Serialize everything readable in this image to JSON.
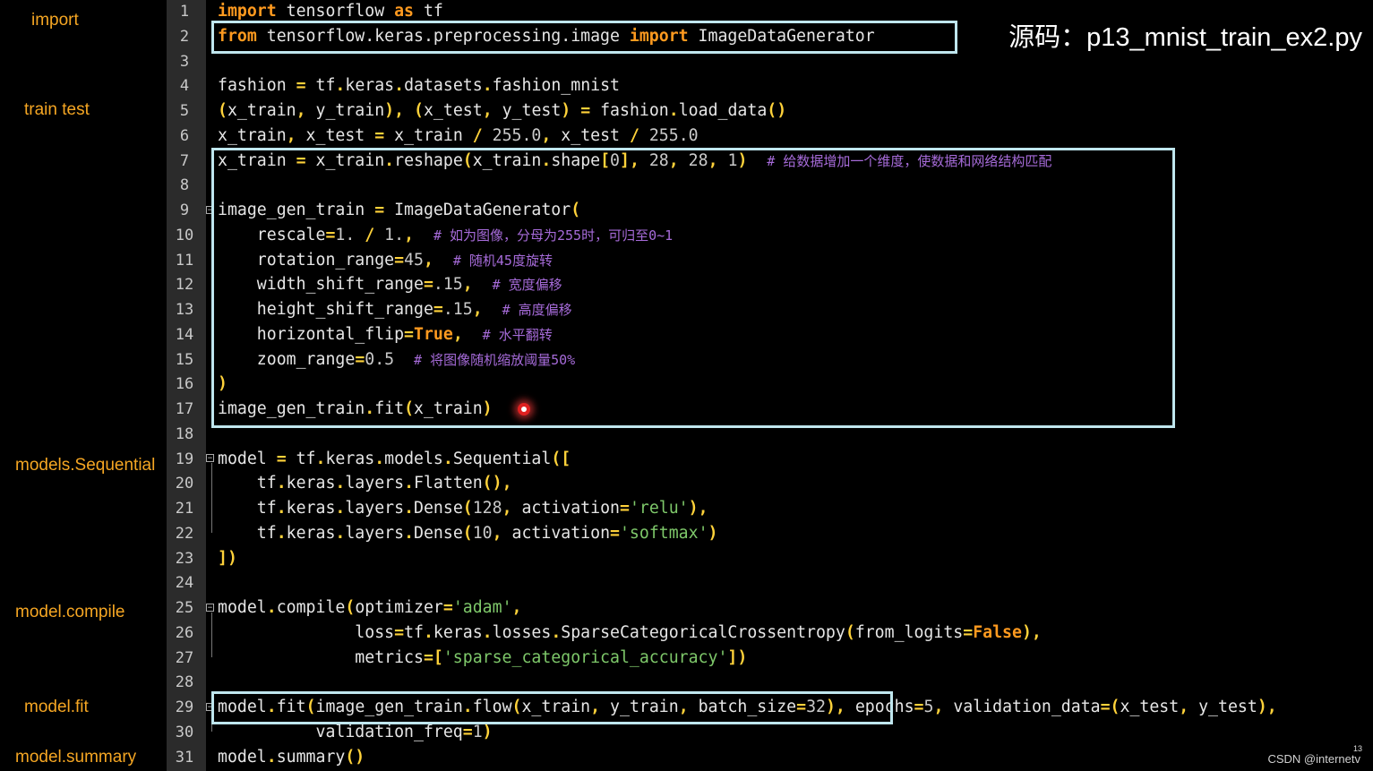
{
  "title": "源码：p13_mnist_train_ex2.py",
  "left_labels": {
    "import": "import",
    "train_test": "train  test",
    "sequential": "models.Sequential",
    "compile": "model.compile",
    "fit": "model.fit",
    "summary": "model.summary"
  },
  "line_numbers": [
    "1",
    "2",
    "3",
    "4",
    "5",
    "6",
    "7",
    "8",
    "9",
    "10",
    "11",
    "12",
    "13",
    "14",
    "15",
    "16",
    "17",
    "18",
    "19",
    "20",
    "21",
    "22",
    "23",
    "24",
    "25",
    "26",
    "27",
    "28",
    "29",
    "30",
    "31"
  ],
  "code": {
    "l1": [
      {
        "t": "import",
        "c": "kw"
      },
      {
        "t": " tensorflow "
      },
      {
        "t": "as",
        "c": "kw"
      },
      {
        "t": " tf"
      }
    ],
    "l2": [
      {
        "t": "from",
        "c": "kw"
      },
      {
        "t": " tensorflow.keras.preprocessing.image "
      },
      {
        "t": "import",
        "c": "kw"
      },
      {
        "t": " ImageDataGenerator"
      }
    ],
    "l3": [],
    "l4": [
      {
        "t": "fashion "
      },
      {
        "t": "=",
        "c": "op"
      },
      {
        "t": " tf"
      },
      {
        "t": ".",
        "c": "op"
      },
      {
        "t": "keras"
      },
      {
        "t": ".",
        "c": "op"
      },
      {
        "t": "datasets"
      },
      {
        "t": ".",
        "c": "op"
      },
      {
        "t": "fashion_mnist"
      }
    ],
    "l5": [
      {
        "t": "(",
        "c": "op"
      },
      {
        "t": "x_train"
      },
      {
        "t": ",",
        "c": "op"
      },
      {
        "t": " y_train"
      },
      {
        "t": "),",
        "c": "op"
      },
      {
        "t": " "
      },
      {
        "t": "(",
        "c": "op"
      },
      {
        "t": "x_test"
      },
      {
        "t": ",",
        "c": "op"
      },
      {
        "t": " y_test"
      },
      {
        "t": ")",
        "c": "op"
      },
      {
        "t": " "
      },
      {
        "t": "=",
        "c": "op"
      },
      {
        "t": " fashion"
      },
      {
        "t": ".",
        "c": "op"
      },
      {
        "t": "load_data"
      },
      {
        "t": "()",
        "c": "op"
      }
    ],
    "l6": [
      {
        "t": "x_train"
      },
      {
        "t": ",",
        "c": "op"
      },
      {
        "t": " x_test "
      },
      {
        "t": "=",
        "c": "op"
      },
      {
        "t": " x_train "
      },
      {
        "t": "/",
        "c": "op"
      },
      {
        "t": " 255.0",
        "c": "num"
      },
      {
        "t": ",",
        "c": "op"
      },
      {
        "t": " x_test "
      },
      {
        "t": "/",
        "c": "op"
      },
      {
        "t": " 255.0",
        "c": "num"
      }
    ],
    "l7": [
      {
        "t": "x_train "
      },
      {
        "t": "=",
        "c": "op"
      },
      {
        "t": " x_train"
      },
      {
        "t": ".",
        "c": "op"
      },
      {
        "t": "reshape"
      },
      {
        "t": "(",
        "c": "op"
      },
      {
        "t": "x_train"
      },
      {
        "t": ".",
        "c": "op"
      },
      {
        "t": "shape"
      },
      {
        "t": "[",
        "c": "op"
      },
      {
        "t": "0",
        "c": "num"
      },
      {
        "t": "],",
        "c": "op"
      },
      {
        "t": " 28",
        "c": "num"
      },
      {
        "t": ",",
        "c": "op"
      },
      {
        "t": " 28",
        "c": "num"
      },
      {
        "t": ",",
        "c": "op"
      },
      {
        "t": " 1",
        "c": "num"
      },
      {
        "t": ")",
        "c": "op"
      },
      {
        "t": "  "
      },
      {
        "t": "# 给数据增加一个维度，使数据和网络结构匹配",
        "c": "cmt"
      }
    ],
    "l8": [],
    "l9": [
      {
        "t": "image_gen_train "
      },
      {
        "t": "=",
        "c": "op"
      },
      {
        "t": " ImageDataGenerator"
      },
      {
        "t": "(",
        "c": "op"
      }
    ],
    "l10": [
      {
        "t": "    rescale"
      },
      {
        "t": "=",
        "c": "op"
      },
      {
        "t": "1.",
        "c": "num"
      },
      {
        "t": " "
      },
      {
        "t": "/",
        "c": "op"
      },
      {
        "t": " 1.",
        "c": "num"
      },
      {
        "t": ",",
        "c": "op"
      },
      {
        "t": "  "
      },
      {
        "t": "# 如为图像，分母为255时，可归至0~1",
        "c": "cmt"
      }
    ],
    "l11": [
      {
        "t": "    rotation_range"
      },
      {
        "t": "=",
        "c": "op"
      },
      {
        "t": "45",
        "c": "num"
      },
      {
        "t": ",",
        "c": "op"
      },
      {
        "t": "  "
      },
      {
        "t": "# 随机45度旋转",
        "c": "cmt"
      }
    ],
    "l12": [
      {
        "t": "    width_shift_range"
      },
      {
        "t": "=",
        "c": "op"
      },
      {
        "t": ".15",
        "c": "num"
      },
      {
        "t": ",",
        "c": "op"
      },
      {
        "t": "  "
      },
      {
        "t": "# 宽度偏移",
        "c": "cmt"
      }
    ],
    "l13": [
      {
        "t": "    height_shift_range"
      },
      {
        "t": "=",
        "c": "op"
      },
      {
        "t": ".15",
        "c": "num"
      },
      {
        "t": ",",
        "c": "op"
      },
      {
        "t": "  "
      },
      {
        "t": "# 高度偏移",
        "c": "cmt"
      }
    ],
    "l14": [
      {
        "t": "    horizontal_flip"
      },
      {
        "t": "=",
        "c": "op"
      },
      {
        "t": "True",
        "c": "kw"
      },
      {
        "t": ",",
        "c": "op"
      },
      {
        "t": "  "
      },
      {
        "t": "# 水平翻转",
        "c": "cmt"
      }
    ],
    "l15": [
      {
        "t": "    zoom_range"
      },
      {
        "t": "=",
        "c": "op"
      },
      {
        "t": "0.5",
        "c": "num"
      },
      {
        "t": "  "
      },
      {
        "t": "# 将图像随机缩放阈量50%",
        "c": "cmt"
      }
    ],
    "l16": [
      {
        "t": ")",
        "c": "op"
      }
    ],
    "l17": [
      {
        "t": "image_gen_train"
      },
      {
        "t": ".",
        "c": "op"
      },
      {
        "t": "fit"
      },
      {
        "t": "(",
        "c": "op"
      },
      {
        "t": "x_train"
      },
      {
        "t": ")",
        "c": "op"
      }
    ],
    "l18": [],
    "l19": [
      {
        "t": "model "
      },
      {
        "t": "=",
        "c": "op"
      },
      {
        "t": " tf"
      },
      {
        "t": ".",
        "c": "op"
      },
      {
        "t": "keras"
      },
      {
        "t": ".",
        "c": "op"
      },
      {
        "t": "models"
      },
      {
        "t": ".",
        "c": "op"
      },
      {
        "t": "Sequential"
      },
      {
        "t": "([",
        "c": "op"
      }
    ],
    "l20": [
      {
        "t": "    tf"
      },
      {
        "t": ".",
        "c": "op"
      },
      {
        "t": "keras"
      },
      {
        "t": ".",
        "c": "op"
      },
      {
        "t": "layers"
      },
      {
        "t": ".",
        "c": "op"
      },
      {
        "t": "Flatten"
      },
      {
        "t": "(),",
        "c": "op"
      }
    ],
    "l21": [
      {
        "t": "    tf"
      },
      {
        "t": ".",
        "c": "op"
      },
      {
        "t": "keras"
      },
      {
        "t": ".",
        "c": "op"
      },
      {
        "t": "layers"
      },
      {
        "t": ".",
        "c": "op"
      },
      {
        "t": "Dense"
      },
      {
        "t": "(",
        "c": "op"
      },
      {
        "t": "128",
        "c": "num"
      },
      {
        "t": ",",
        "c": "op"
      },
      {
        "t": " activation"
      },
      {
        "t": "=",
        "c": "op"
      },
      {
        "t": "'relu'",
        "c": "str"
      },
      {
        "t": "),",
        "c": "op"
      }
    ],
    "l22": [
      {
        "t": "    tf"
      },
      {
        "t": ".",
        "c": "op"
      },
      {
        "t": "keras"
      },
      {
        "t": ".",
        "c": "op"
      },
      {
        "t": "layers"
      },
      {
        "t": ".",
        "c": "op"
      },
      {
        "t": "Dense"
      },
      {
        "t": "(",
        "c": "op"
      },
      {
        "t": "10",
        "c": "num"
      },
      {
        "t": ",",
        "c": "op"
      },
      {
        "t": " activation"
      },
      {
        "t": "=",
        "c": "op"
      },
      {
        "t": "'softmax'",
        "c": "str"
      },
      {
        "t": ")",
        "c": "op"
      }
    ],
    "l23": [
      {
        "t": "])",
        "c": "op"
      }
    ],
    "l24": [],
    "l25": [
      {
        "t": "model"
      },
      {
        "t": ".",
        "c": "op"
      },
      {
        "t": "compile"
      },
      {
        "t": "(",
        "c": "op"
      },
      {
        "t": "optimizer"
      },
      {
        "t": "=",
        "c": "op"
      },
      {
        "t": "'adam'",
        "c": "str"
      },
      {
        "t": ",",
        "c": "op"
      }
    ],
    "l26": [
      {
        "t": "              loss"
      },
      {
        "t": "=",
        "c": "op"
      },
      {
        "t": "tf"
      },
      {
        "t": ".",
        "c": "op"
      },
      {
        "t": "keras"
      },
      {
        "t": ".",
        "c": "op"
      },
      {
        "t": "losses"
      },
      {
        "t": ".",
        "c": "op"
      },
      {
        "t": "SparseCategoricalCrossentropy"
      },
      {
        "t": "(",
        "c": "op"
      },
      {
        "t": "from_logits"
      },
      {
        "t": "=",
        "c": "op"
      },
      {
        "t": "False",
        "c": "kw"
      },
      {
        "t": "),",
        "c": "op"
      }
    ],
    "l27": [
      {
        "t": "              metrics"
      },
      {
        "t": "=",
        "c": "op"
      },
      {
        "t": "[",
        "c": "op"
      },
      {
        "t": "'sparse_categorical_accuracy'",
        "c": "str"
      },
      {
        "t": "])",
        "c": "op"
      }
    ],
    "l28": [],
    "l29": [
      {
        "t": "model"
      },
      {
        "t": ".",
        "c": "op"
      },
      {
        "t": "fit"
      },
      {
        "t": "(",
        "c": "op"
      },
      {
        "t": "image_gen_train"
      },
      {
        "t": ".",
        "c": "op"
      },
      {
        "t": "flow"
      },
      {
        "t": "(",
        "c": "op"
      },
      {
        "t": "x_train"
      },
      {
        "t": ",",
        "c": "op"
      },
      {
        "t": " y_train"
      },
      {
        "t": ",",
        "c": "op"
      },
      {
        "t": " batch_size"
      },
      {
        "t": "=",
        "c": "op"
      },
      {
        "t": "32",
        "c": "num"
      },
      {
        "t": "),",
        "c": "op"
      },
      {
        "t": " epochs"
      },
      {
        "t": "=",
        "c": "op"
      },
      {
        "t": "5",
        "c": "num"
      },
      {
        "t": ",",
        "c": "op"
      },
      {
        "t": " validation_data"
      },
      {
        "t": "=",
        "c": "op"
      },
      {
        "t": "(",
        "c": "op"
      },
      {
        "t": "x_test"
      },
      {
        "t": ",",
        "c": "op"
      },
      {
        "t": " y_test"
      },
      {
        "t": "),",
        "c": "op"
      }
    ],
    "l30": [
      {
        "t": "          validation_freq"
      },
      {
        "t": "=",
        "c": "op"
      },
      {
        "t": "1",
        "c": "num"
      },
      {
        "t": ")",
        "c": "op"
      }
    ],
    "l31": [
      {
        "t": "model"
      },
      {
        "t": ".",
        "c": "op"
      },
      {
        "t": "summary"
      },
      {
        "t": "()",
        "c": "op"
      }
    ]
  },
  "footer": "CSDN @internetv",
  "page_number": "13",
  "colors": {
    "keyword": "#ff9a1f",
    "operator": "#ffd23a",
    "string": "#7ec86a",
    "comment": "#a66bd9",
    "highlight_box": "#bfe6ee",
    "label": "#f5a623"
  }
}
